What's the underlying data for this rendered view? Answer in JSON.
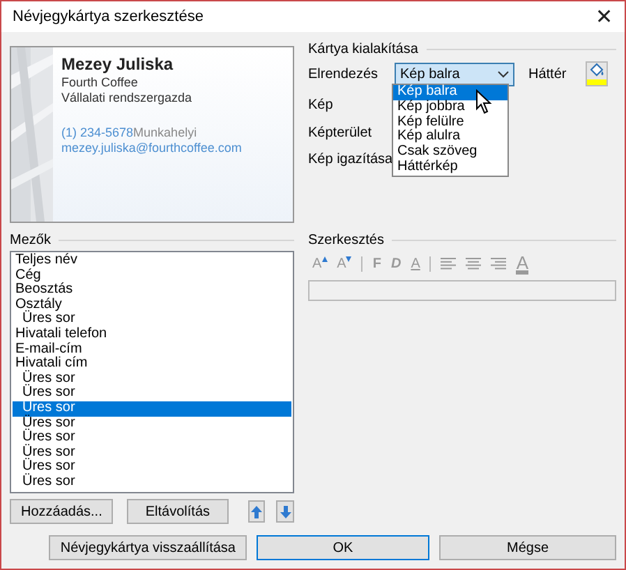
{
  "window": {
    "title": "Névjegykártya szerkesztése",
    "close": "✕"
  },
  "card": {
    "name": "Mezey Juliska",
    "company": "Fourth Coffee",
    "job_title": "Vállalati rendszergazda",
    "phone": "(1) 234-5678",
    "phone_label": "Munkahelyi",
    "email": "mezey.juliska@fourthcoffee.com"
  },
  "design": {
    "title": "Kártya kialakítása",
    "layout": {
      "label": "Elrendezés",
      "value": "Kép balra",
      "expanded": true,
      "options": [
        {
          "label": "Kép balra",
          "selected": true
        },
        {
          "label": "Kép jobbra",
          "selected": false
        },
        {
          "label": "Kép felülre",
          "selected": false
        },
        {
          "label": "Kép alulra",
          "selected": false
        },
        {
          "label": "Csak szöveg",
          "selected": false
        },
        {
          "label": "Háttérkép",
          "selected": false
        }
      ]
    },
    "background": {
      "label": "Háttér",
      "color": "#ffff00"
    },
    "labels": [
      "Kép",
      "Képterület",
      "Kép igazítása"
    ]
  },
  "fields": {
    "title": "Mezők",
    "items": [
      {
        "label": "Teljes név",
        "kind": "field",
        "selected": false
      },
      {
        "label": "Cég",
        "kind": "field",
        "selected": false
      },
      {
        "label": "Beosztás",
        "kind": "field",
        "selected": false
      },
      {
        "label": "Osztály",
        "kind": "field",
        "selected": false
      },
      {
        "label": "Üres sor",
        "kind": "blank",
        "selected": false
      },
      {
        "label": "Hivatali telefon",
        "kind": "field",
        "selected": false
      },
      {
        "label": "E-mail-cím",
        "kind": "field",
        "selected": false
      },
      {
        "label": "Hivatali cím",
        "kind": "field",
        "selected": false
      },
      {
        "label": "Üres sor",
        "kind": "blank",
        "selected": false
      },
      {
        "label": "Üres sor",
        "kind": "blank",
        "selected": false
      },
      {
        "label": "Üres sor",
        "kind": "blank",
        "selected": true
      },
      {
        "label": "Üres sor",
        "kind": "blank",
        "selected": false
      },
      {
        "label": "Üres sor",
        "kind": "blank",
        "selected": false
      },
      {
        "label": "Üres sor",
        "kind": "blank",
        "selected": false
      },
      {
        "label": "Üres sor",
        "kind": "blank",
        "selected": false
      },
      {
        "label": "Üres sor",
        "kind": "blank",
        "selected": false
      }
    ],
    "buttons": [
      "Hozzáadás...",
      "Eltávolítás"
    ]
  },
  "editing": {
    "title": "Szerkesztés",
    "disabled": true,
    "toolbar": [
      {
        "kind": "grow",
        "label": "A"
      },
      {
        "kind": "shrink",
        "label": "A"
      },
      {
        "kind": "separator"
      },
      {
        "kind": "bold",
        "label": "F"
      },
      {
        "kind": "italic",
        "label": "D"
      },
      {
        "kind": "underline",
        "label": "A"
      },
      {
        "kind": "separator"
      },
      {
        "kind": "align-left"
      },
      {
        "kind": "align-center"
      },
      {
        "kind": "align-right"
      },
      {
        "kind": "font-color",
        "label": "A"
      }
    ]
  },
  "buttons": [
    {
      "label": "Névjegykártya visszaállítása",
      "default": false
    },
    {
      "label": "OK",
      "default": true
    },
    {
      "label": "Mégse",
      "default": false
    }
  ]
}
